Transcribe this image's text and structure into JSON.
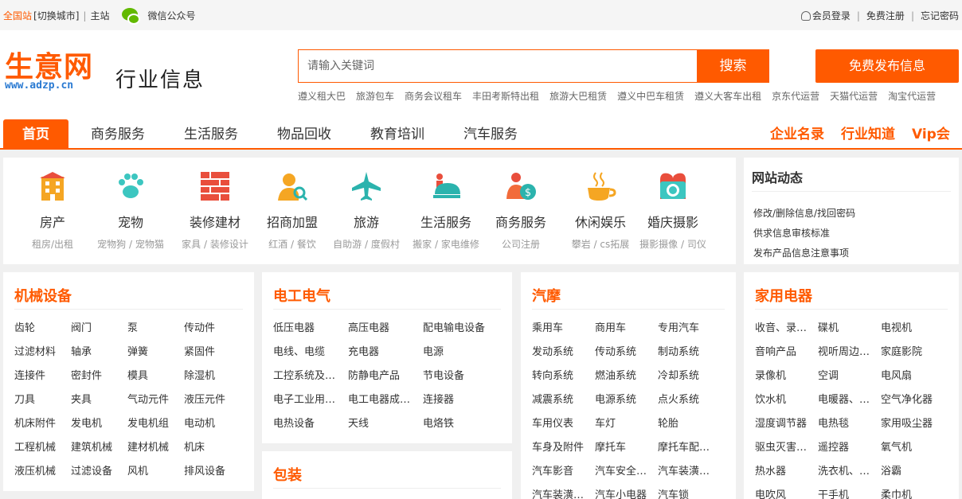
{
  "topbar": {
    "city": "全国站",
    "switch": "[切换城市]",
    "main": "主站",
    "wechat": "微信公众号",
    "login": "会员登录",
    "register": "免费注册",
    "forgot": "忘记密码"
  },
  "header": {
    "logo_cn": "生意网",
    "logo_en": "www.adzp.cn",
    "slogan": "行业信息",
    "search_placeholder": "请输入关键词",
    "search_btn": "搜索",
    "publish_btn": "免费发布信息",
    "hot": [
      "遵义租大巴",
      "旅游包车",
      "商务会议租车",
      "丰田考斯特出租",
      "旅游大巴租赁",
      "遵义中巴车租赁",
      "遵义大客车出租",
      "京东代运营",
      "天猫代运营",
      "淘宝代运营"
    ]
  },
  "nav": {
    "items": [
      "首页",
      "商务服务",
      "生活服务",
      "物品回收",
      "教育培训",
      "汽车服务"
    ],
    "right": [
      "企业名录",
      "行业知道",
      "Vip会员"
    ]
  },
  "categories": [
    {
      "name": "房产",
      "sub": "租房/出租",
      "icon": "building-icon",
      "color": "#f5a623"
    },
    {
      "name": "宠物",
      "sub": "宠物狗 / 宠物猫",
      "icon": "paw-icon",
      "color": "#3cc6c0"
    },
    {
      "name": "装修建材",
      "sub": "家具 / 装修设计",
      "icon": "brick-wall-icon",
      "color": "#e94e3c"
    },
    {
      "name": "招商加盟",
      "sub": "红酒 / 餐饮",
      "icon": "person-search-icon",
      "color": "#f5a623"
    },
    {
      "name": "旅游",
      "sub": "自助游 / 度假村",
      "icon": "airplane-icon",
      "color": "#2bb3ad"
    },
    {
      "name": "生活服务",
      "sub": "搬家 / 家电维修",
      "icon": "service-bell-icon",
      "color": "#2bb3ad"
    },
    {
      "name": "商务服务",
      "sub": "公司注册",
      "icon": "business-money-icon",
      "color": "#f26b3a"
    },
    {
      "name": "休闲娱乐",
      "sub": "攀岩 / cs拓展",
      "icon": "coffee-icon",
      "color": "#f5a623"
    },
    {
      "name": "婚庆摄影",
      "sub": "摄影摄像 / 司仪",
      "icon": "camera-icon",
      "color": "#3cc6c0"
    }
  ],
  "news": {
    "title": "网站动态",
    "items": [
      "修改/删除信息/找回密码",
      "供求信息审核标准",
      "发布产品信息注意事项"
    ]
  },
  "sections": [
    {
      "title": "机械设备",
      "items": [
        "齿轮",
        "阀门",
        "泵",
        "传动件",
        "过滤材料",
        "轴承",
        "弹簧",
        "紧固件",
        "连接件",
        "密封件",
        "模具",
        "除湿机",
        "刀具",
        "夹具",
        "气动元件",
        "液压元件",
        "机床附件",
        "发电机",
        "发电机组",
        "电动机",
        "工程机械",
        "建筑机械",
        "建材机械",
        "机床",
        "液压机械",
        "过滤设备",
        "风机",
        "排风设备"
      ]
    },
    {
      "title": "电工电气",
      "items": [
        "低压电器",
        "高压电器",
        "配电输电设备",
        "电线、电缆",
        "充电器",
        "电源",
        "工控系统及…",
        "防静电产品",
        "节电设备",
        "电子工业用…",
        "电工电器成…",
        "连接器",
        "电热设备",
        "天线",
        "电烙铁"
      ]
    },
    {
      "title": "包装",
      "items": []
    },
    {
      "title": "汽摩",
      "items": [
        "乘用车",
        "商用车",
        "专用汽车",
        "发动系统",
        "传动系统",
        "制动系统",
        "转向系统",
        "燃油系统",
        "冷却系统",
        "减震系统",
        "电源系统",
        "点火系统",
        "车用仪表",
        "车灯",
        "轮胎",
        "车身及附件",
        "摩托车",
        "摩托车配…",
        "汽车影音",
        "汽车安全…",
        "汽车装潢…",
        "汽车装潢…",
        "汽车小电器",
        "汽车锁"
      ]
    },
    {
      "title": "家用电器",
      "items": [
        "收音、录…",
        "碟机",
        "电视机",
        "音响产品",
        "视听周边…",
        "家庭影院",
        "录像机",
        "空调",
        "电风扇",
        "饮水机",
        "电暖器、…",
        "空气净化器",
        "湿度调节器",
        "电热毯",
        "家用吸尘器",
        "驱虫灭害…",
        "遥控器",
        "氧气机",
        "热水器",
        "洗衣机、…",
        "浴霸",
        "电吹风",
        "干手机",
        "柔巾机"
      ]
    }
  ]
}
